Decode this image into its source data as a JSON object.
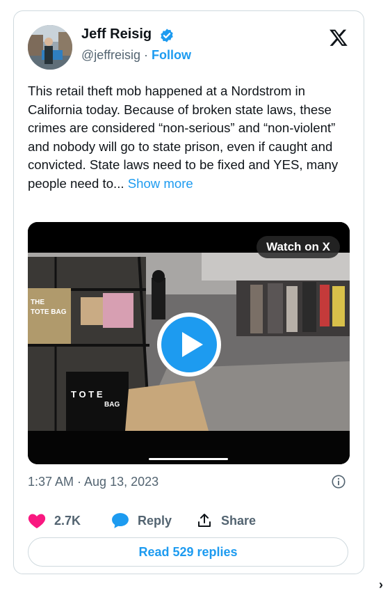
{
  "author": {
    "name": "Jeff Reisig",
    "handle": "@jeffreisig",
    "separator": "·",
    "follow_label": "Follow",
    "verified_color": "#1d9bf0"
  },
  "tweet": {
    "text": "This retail theft mob happened at a Nordstrom in California today. Because of broken state laws, these crimes are considered “non-serious” and “non-violent” and nobody will go to state prison, even if caught and convicted. State laws need to be fixed and YES, many people need to...",
    "show_more_label": "Show more"
  },
  "media": {
    "watch_label": "Watch on X",
    "bag_text_left": "THE TOTE BAG",
    "bag_text_front": "THE TOTE BAG"
  },
  "meta": {
    "timestamp": "1:37 AM · Aug 13, 2023"
  },
  "actions": {
    "likes": "2.7K",
    "reply_label": "Reply",
    "share_label": "Share",
    "read_replies": "Read 529 replies"
  },
  "colors": {
    "accent": "#1d9bf0",
    "like": "#f91880",
    "muted": "#536471"
  },
  "icons": [
    "verified-badge-icon",
    "x-logo-icon",
    "play-icon",
    "info-icon",
    "heart-icon",
    "reply-bubble-icon",
    "share-icon",
    "chevron-right-icon"
  ],
  "nav": {
    "chevron": "›"
  }
}
